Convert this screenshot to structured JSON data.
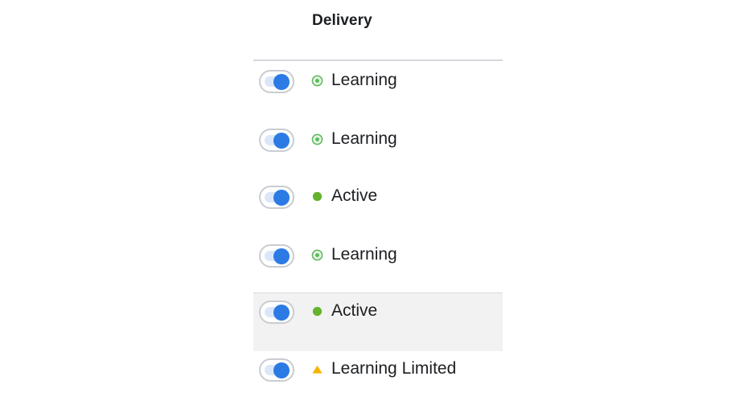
{
  "header": {
    "title": "Delivery"
  },
  "colors": {
    "toggle_on": "#2c7be5",
    "learning": "#5cb85c",
    "active": "#63b32e",
    "limited": "#f5b400"
  },
  "rows": [
    {
      "toggle_on": true,
      "status_icon": "learning-icon",
      "status_label": "Learning"
    },
    {
      "toggle_on": true,
      "status_icon": "learning-icon",
      "status_label": "Learning"
    },
    {
      "toggle_on": true,
      "status_icon": "active-dot-icon",
      "status_label": "Active"
    },
    {
      "toggle_on": true,
      "status_icon": "learning-icon",
      "status_label": "Learning"
    },
    {
      "toggle_on": true,
      "status_icon": "active-dot-icon",
      "status_label": "Active"
    },
    {
      "toggle_on": true,
      "status_icon": "warning-triangle-icon",
      "status_label": "Learning Limited"
    }
  ]
}
